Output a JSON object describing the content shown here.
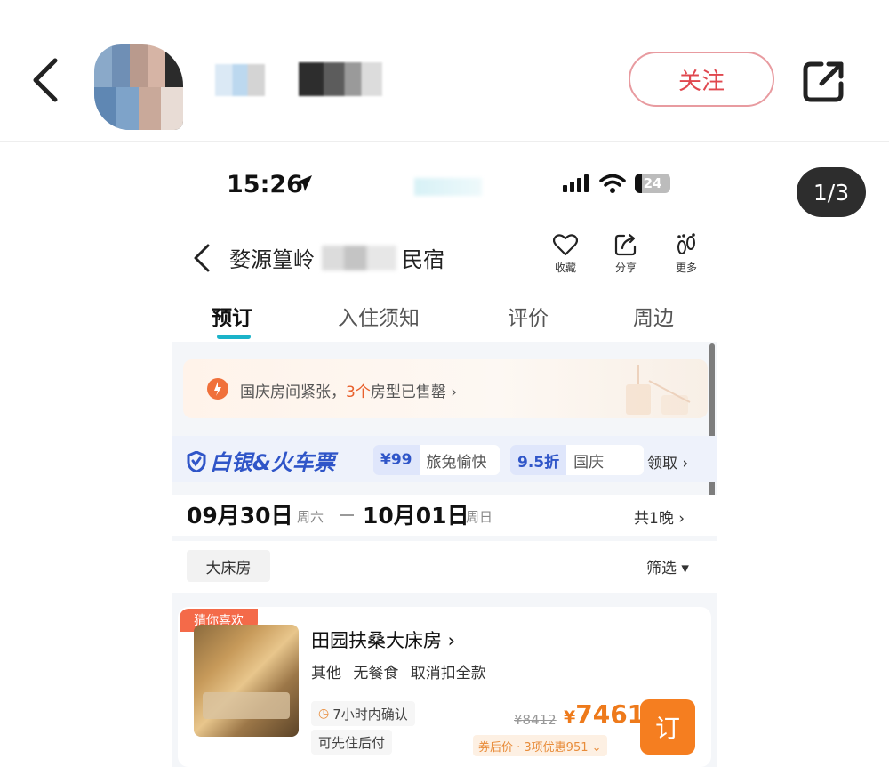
{
  "header": {
    "follow_label": "关注"
  },
  "status_bar": {
    "time": "15:26",
    "battery": "24"
  },
  "page_indicator": "1/3",
  "hotel": {
    "title_prefix": "婺源篁岭",
    "title_suffix": "民宿",
    "actions": [
      {
        "label": "收藏",
        "icon": "heart-icon"
      },
      {
        "label": "分享",
        "icon": "share-icon"
      },
      {
        "label": "更多",
        "icon": "footprint-icon"
      }
    ]
  },
  "tabs": [
    {
      "label": "预订",
      "active": true
    },
    {
      "label": "入住须知",
      "active": false
    },
    {
      "label": "评价",
      "active": false
    },
    {
      "label": "周边",
      "active": false
    }
  ],
  "notice": {
    "text_before": "国庆房间紧张，",
    "highlight": "3个",
    "text_after": "房型已售罄 ›"
  },
  "promo": {
    "logo": "白银&火车票",
    "chips": [
      {
        "price": "¥99",
        "label": "旅兔愉快"
      },
      {
        "price": "9.5折",
        "label": "国庆"
      }
    ],
    "claim": "领取 ›"
  },
  "dates": {
    "checkin": "09月30日",
    "checkin_week": "周六",
    "checkout": "10月01日",
    "checkout_week": "周日",
    "nights": "共1晚 ›"
  },
  "filter": {
    "room_chip": "大床房",
    "filter_label": "筛选 ▾"
  },
  "room": {
    "tag": "猜你喜欢",
    "name": "田园扶桑大床房 ›",
    "desc": "其他 无餐食 取消扣全款",
    "confirm": "7小时内确认",
    "pay": "可先住后付",
    "price_old": "¥8412",
    "price_currency": "¥",
    "price_new": "7461",
    "discount_note": "券后价 · 3项优惠951 ⌄",
    "book_label": "订"
  },
  "colors": {
    "accent_teal": "#1bb3c9",
    "price_orange": "#ee7a1b",
    "book_orange": "#f57e20",
    "follow_red": "#e0484f",
    "promo_blue": "#2f55c8"
  }
}
